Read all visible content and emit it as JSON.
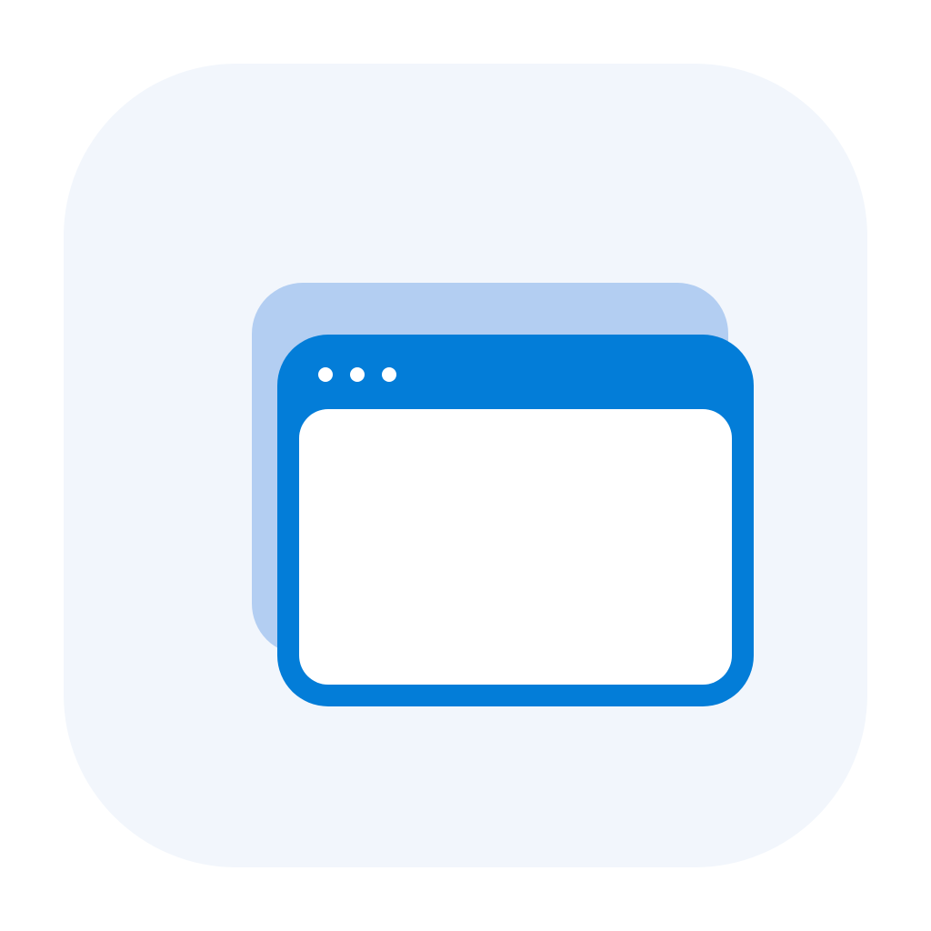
{
  "icon": {
    "name": "multiple-windows-icon",
    "colors": {
      "tile_background": "#f2f6fc",
      "back_window": "#b3cef2",
      "front_window_frame": "#037dd8",
      "front_window_content": "#ffffff",
      "title_dots": "#ffffff"
    },
    "title_dot_count": 3
  }
}
